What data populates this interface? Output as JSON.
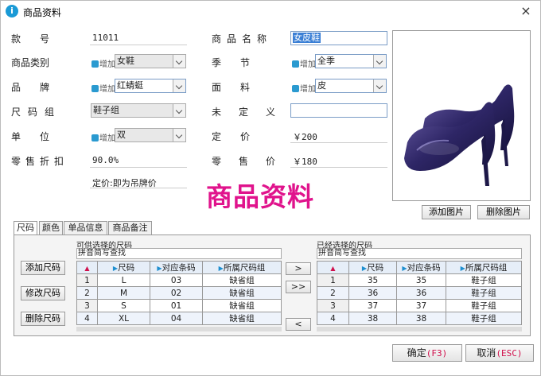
{
  "window": {
    "title": "商品资料",
    "close_icon": "×",
    "app_icon": "i"
  },
  "form": {
    "code": {
      "label": "款　　号",
      "value": "11011"
    },
    "name": {
      "label": "商品名称",
      "value": "女皮鞋"
    },
    "category": {
      "label": "商品类别",
      "value": "女鞋",
      "add": "增加"
    },
    "season": {
      "label": "季　　节",
      "value": "全季",
      "add": "增加"
    },
    "brand": {
      "label": "品　　牌",
      "value": "红蜻蜓",
      "add": "增加"
    },
    "material": {
      "label": "面　　料",
      "value": "皮",
      "add": "增加"
    },
    "size_group": {
      "label": "尺码组",
      "value": "鞋子组"
    },
    "undefined": {
      "label": "未定义",
      "value": ""
    },
    "unit": {
      "label": "单　　位",
      "value": "双",
      "add": "增加"
    },
    "price": {
      "label": "定　　价",
      "value": "￥200"
    },
    "discount": {
      "label": "零售折扣",
      "value": "90.0%"
    },
    "retail": {
      "label": "零售价",
      "value": "￥180"
    },
    "note": "定价:即为吊牌价"
  },
  "photo": {
    "add_btn": "添加图片",
    "delete_btn": "删除图片"
  },
  "banner": "商品资料",
  "tabs": [
    "尺码",
    "颜色",
    "单品信息",
    "商品备注"
  ],
  "size_panel": {
    "left_title": "可供选择的尺码",
    "right_title": "已经选择的尺码",
    "search_label": "拼音简写查找",
    "left_buttons": [
      "添加尺码",
      "修改尺码",
      "删除尺码"
    ],
    "move_buttons": [
      ">",
      ">>",
      "<"
    ],
    "left_headers": [
      "尺码",
      "对应条码",
      "所属尺码组"
    ],
    "left_rows": [
      [
        "1",
        "L",
        "03",
        "缺省组"
      ],
      [
        "2",
        "M",
        "02",
        "缺省组"
      ],
      [
        "3",
        "S",
        "01",
        "缺省组"
      ],
      [
        "4",
        "XL",
        "04",
        "缺省组"
      ]
    ],
    "right_headers": [
      "尺码",
      "对应条码",
      "所属尺码组"
    ],
    "right_rows": [
      [
        "1",
        "35",
        "35",
        "鞋子组"
      ],
      [
        "2",
        "36",
        "36",
        "鞋子组"
      ],
      [
        "3",
        "37",
        "37",
        "鞋子组"
      ],
      [
        "4",
        "38",
        "38",
        "鞋子组"
      ]
    ]
  },
  "footer": {
    "ok": "确定",
    "ok_key": "(F3)",
    "cancel": "取消",
    "cancel_key": "(ESC)"
  },
  "colors": {
    "banner": "#e0138c",
    "accent": "#1e8fd0"
  }
}
